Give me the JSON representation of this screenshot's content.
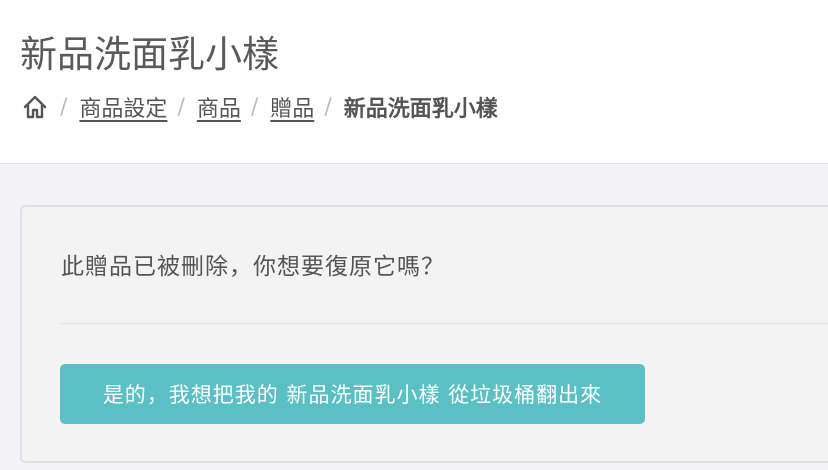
{
  "header": {
    "title": "新品洗面乳小樣",
    "breadcrumb": {
      "home_icon": "home-icon",
      "items": [
        "商品設定",
        "商品",
        "贈品"
      ],
      "current": "新品洗面乳小樣",
      "separator": "/"
    }
  },
  "panel": {
    "message": "此贈品已被刪除，你想要復原它嗎？",
    "restore_button_label": "是的，我想把我的 新品洗面乳小樣 從垃圾桶翻出來"
  },
  "colors": {
    "button": "#5bc0c4",
    "page_background": "#f4f4f8",
    "header_background": "#ffffff"
  }
}
